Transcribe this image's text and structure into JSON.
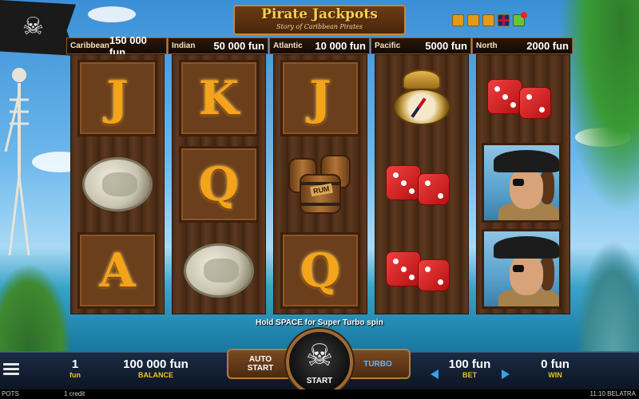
{
  "title": {
    "main": "Pirate Jackpots",
    "subtitle": "Story of Caribbean Pirates"
  },
  "top_icons": [
    "home-icon",
    "sound-icon",
    "info-icon",
    "language-flag-uk-icon",
    "gift-icon"
  ],
  "jackpots": [
    {
      "name": "Caribbean",
      "value": "150 000 fun"
    },
    {
      "name": "Indian",
      "value": "50 000 fun"
    },
    {
      "name": "Atlantic",
      "value": "10 000 fun"
    },
    {
      "name": "Pacific",
      "value": "5000 fun"
    },
    {
      "name": "North",
      "value": "2000 fun"
    }
  ],
  "reels": [
    [
      "J",
      "coin",
      "A"
    ],
    [
      "K",
      "Q",
      "coin"
    ],
    [
      "J",
      "barrels",
      "Q"
    ],
    [
      "compass",
      "dice",
      "dice"
    ],
    [
      "dice",
      "pirate",
      "pirate"
    ]
  ],
  "barrel_label": "RUM",
  "hint": "Hold SPACE for Super Turbo spin",
  "panel": {
    "lines_value": "1",
    "lines_label": "fun",
    "balance_value": "100 000 fun",
    "balance_label": "BALANCE",
    "auto_start_label": "AUTO START",
    "start_label": "START",
    "turbo_label": "TURBO",
    "bet_value": "100 fun",
    "bet_label": "BET",
    "win_value": "0 fun",
    "win_label": "WIN"
  },
  "statusbar": {
    "left": "POTS",
    "credit": "1 credit",
    "right": "11:10 BELATRA"
  },
  "colors": {
    "gold": "#f0c020",
    "letter_orange": "#f3a41b",
    "panel_dark": "#0b1525",
    "arrow_blue": "#3aa0e8"
  }
}
